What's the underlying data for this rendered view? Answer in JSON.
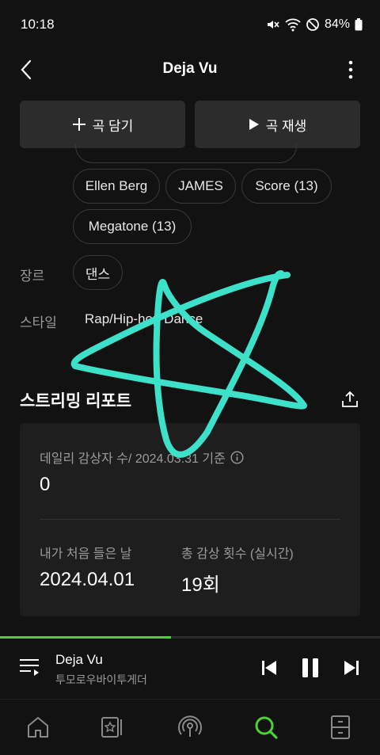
{
  "status_bar": {
    "time": "10:18",
    "battery": "84%"
  },
  "header": {
    "title": "Deja Vu"
  },
  "actions": {
    "add_label": "곡 담기",
    "play_label": "곡 재생"
  },
  "artist_chips": [
    "Ellen Berg",
    "JAMES",
    "Score (13)",
    "Megatone (13)"
  ],
  "genre": {
    "label": "장르",
    "value": "댄스"
  },
  "style": {
    "label": "스타일",
    "value": "Rap/Hip-hop Dance"
  },
  "streaming_report": {
    "title": "스트리밍 리포트",
    "daily_label": "데일리 감상자 수/ 2024.03.31 기준",
    "daily_value": "0",
    "first_listen_label": "내가 처음 들은 날",
    "first_listen_value": "2024.04.01",
    "total_plays_label": "총 감상 횟수 (실시간)",
    "total_plays_value": "19회"
  },
  "now_playing": {
    "title": "Deja Vu",
    "artist": "투모로우바이투게더",
    "progress": 0.45
  },
  "colors": {
    "accent": "#4cd137",
    "background": "#121212",
    "card": "#1e1e1e",
    "annotation": "#3de0c8"
  },
  "bottom_nav": [
    "home-icon",
    "library-icon",
    "podcast-icon",
    "search-icon",
    "more-menu-icon"
  ]
}
